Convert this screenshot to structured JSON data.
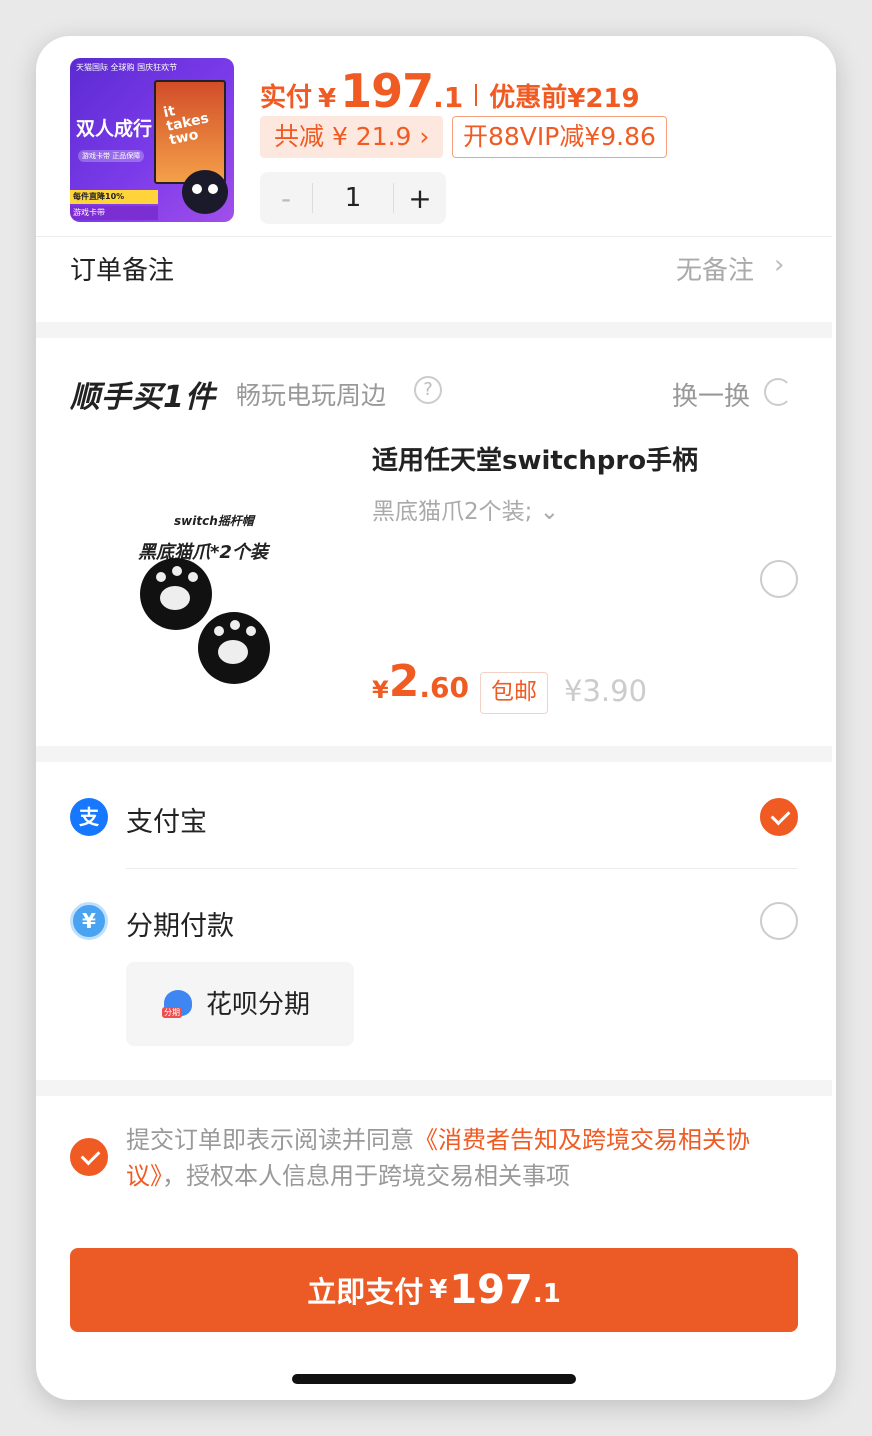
{
  "product": {
    "thumb_topbar": "天猫国际 全球购 国庆狂欢节",
    "thumb_title": "双人成行",
    "thumb_pill": "游戏卡带 正品保障",
    "thumb_box_text": "it takes two",
    "thumb_promo": "每件直降10%",
    "thumb_promo2": "游戏卡带",
    "actual_label": "实付",
    "currency": "¥",
    "price_int": "197",
    "price_dec": ".1",
    "before_label": "优惠前",
    "before_price": "¥219",
    "save_label": "共减 ¥ 21.9 ›",
    "vip_label": "开88VIP减¥9.86",
    "quantity": "1",
    "minus": "-",
    "plus": "+"
  },
  "remark": {
    "label": "订单备注",
    "value": "无备注",
    "chevron": "›"
  },
  "addon": {
    "title": "顺手买1件",
    "subtitle": "畅玩电玩周边",
    "help": "?",
    "swap_label": "换一换",
    "image_caption_1": "switch摇杆帽",
    "image_caption_2": "黑底猫爪*2个装",
    "name": "适用任天堂switchpro手柄",
    "variant": "黑底猫爪2个装; ⌄",
    "currency": "¥",
    "price_int": "2",
    "price_dec": ".60",
    "shipping": "包邮",
    "original_price": "¥3.90"
  },
  "payment": {
    "alipay_icon": "支",
    "alipay_label": "支付宝",
    "installment_icon": "¥",
    "installment_label": "分期付款",
    "huabei_badge": "分期",
    "huabei_label": "花呗分期"
  },
  "agreement": {
    "prefix": "提交订单即表示阅读并同意",
    "link": "《消费者告知及跨境交易相关协议》",
    "suffix": "，授权本人信息用于跨境交易相关事项"
  },
  "pay_button": {
    "label": "立即支付",
    "currency": "¥",
    "price_int": "197",
    "price_dec": ".1"
  },
  "colors": {
    "accent": "#ec5b25",
    "alipay": "#1677ff",
    "installment": "#4aa3f0"
  }
}
